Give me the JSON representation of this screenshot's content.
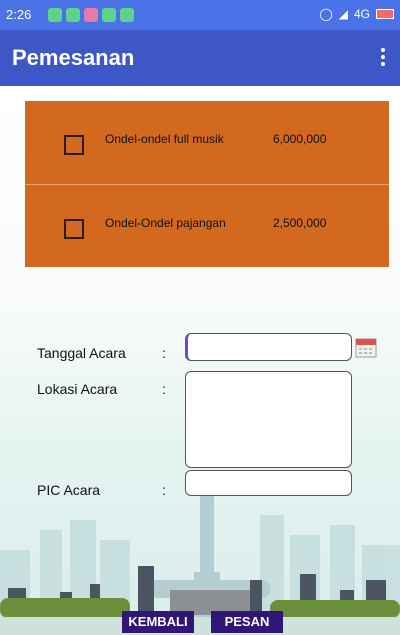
{
  "status_bar": {
    "time": "2:26",
    "network": "4G"
  },
  "app_bar": {
    "title": "Pemesanan",
    "menu_icon": "more-vert-icon"
  },
  "items": [
    {
      "name": "Ondel-ondel full musik",
      "price": "6,000,000",
      "checked": false
    },
    {
      "name": "Ondel-Ondel pajangan",
      "price": "2,500,000",
      "checked": false
    }
  ],
  "form": {
    "tanggal_label": "Tanggal Acara",
    "lokasi_label": "Lokasi Acara",
    "pic_label": "PIC Acara",
    "colon": ":",
    "tanggal_value": "",
    "lokasi_value": "",
    "pic_value": ""
  },
  "buttons": {
    "back": "KEMBALI",
    "order": "PESAN"
  },
  "colors": {
    "app_bar": "#3d57c6",
    "status_bar": "#4a73e8",
    "card": "#d3691e",
    "button": "#301776"
  }
}
